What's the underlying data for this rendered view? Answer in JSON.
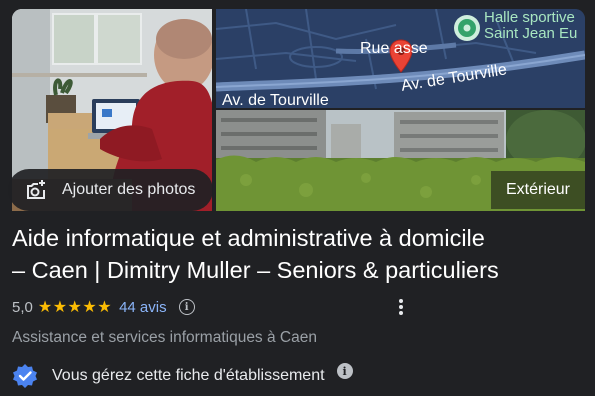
{
  "photos": {
    "add_photos_label": "Ajouter des photos",
    "exterior_label": "Extérieur"
  },
  "map": {
    "street_top": "Rue asse",
    "street_left": "Av. de Tourville",
    "street_right": "Av. de Tourville",
    "poi_line1": "Halle sportive",
    "poi_line2": "Saint Jean Eu"
  },
  "business": {
    "title_line1": "Aide informatique et administrative à domicile",
    "title_line2": "– Caen | Dimitry Muller – Seniors & particuliers",
    "rating": "5,0",
    "stars": "★★★★★",
    "reviews": "44 avis",
    "category": "Assistance et services informatiques à Caen",
    "manage_text": "Vous gérez cette fiche d'établissement"
  },
  "icons": {
    "camera": "camera-add-icon",
    "info": "info-icon",
    "more": "more-vert-icon",
    "verified": "verified-badge-icon",
    "pin": "map-pin-icon",
    "poi": "poi-icon"
  },
  "colors": {
    "background": "#202124",
    "star": "#fbbc04",
    "link": "#8ab4f8",
    "verified": "#4b83f0",
    "pin": "#ea4335"
  }
}
